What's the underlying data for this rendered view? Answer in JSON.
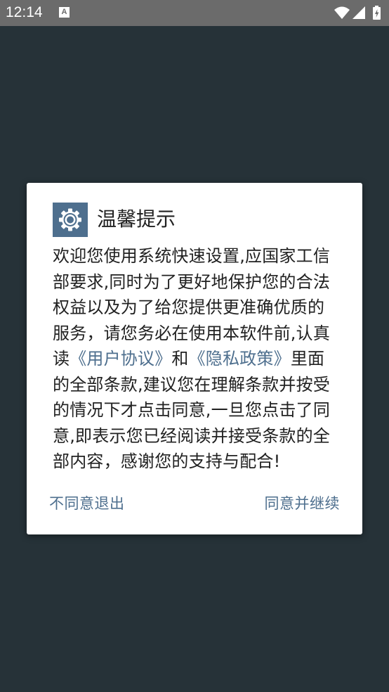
{
  "status_bar": {
    "time": "12:14",
    "notification_icon": "A"
  },
  "dialog": {
    "title": "温馨提示",
    "icon": "gear-icon",
    "body": {
      "part1": "欢迎您使用系统快速设置,应国家工信部要求,同时为了更好地保护您的合法权益以及为了给您提供更准确优质的服务，请您务必在使用本软件前,认真读",
      "link1": "《用户协议》",
      "part2": "和",
      "link2": "《隐私政策》",
      "part3": "里面的全部条款,建议您在理解条款并按受的情况下才点击同意,一旦您点击了同意,即表示您已经阅读并接受条款的全部内容，感谢您的支持与配合!"
    },
    "buttons": {
      "disagree": "不同意退出",
      "agree": "同意并继续"
    }
  },
  "colors": {
    "background": "#263238",
    "status_bar": "#6b6b6b",
    "accent": "#4e6f8e",
    "text": "#212121"
  }
}
